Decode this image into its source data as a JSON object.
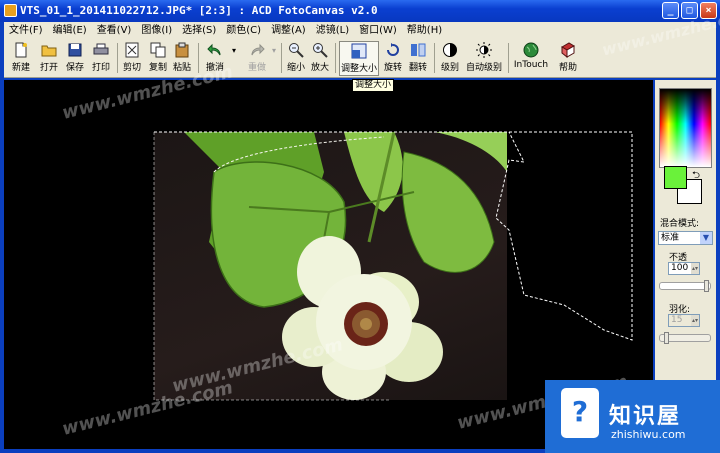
{
  "window": {
    "title": "VTS_01_1_201411022712.JPG* [2:3] : ACD FotoCanvas v2.0",
    "controls": [
      "_",
      "□",
      "×"
    ]
  },
  "menu": [
    "文件(F)",
    "编辑(E)",
    "查看(V)",
    "图像(I)",
    "选择(S)",
    "颜色(C)",
    "调整(A)",
    "滤镜(L)",
    "窗口(W)",
    "帮助(H)"
  ],
  "toolbar": {
    "new": "新建",
    "open": "打开",
    "save": "保存",
    "print": "打印",
    "cut": "剪切",
    "copy": "复制",
    "paste": "粘贴",
    "undo": "撤消",
    "redo": "重做",
    "zoom_out": "缩小",
    "zoom_in": "放大",
    "resize": "调整大小",
    "rotate": "旋转",
    "flip": "翻转",
    "levels": "级别",
    "auto_levels": "自动级别",
    "intouch": "InTouch",
    "help": "帮助"
  },
  "tooltip": "调整大小",
  "panel": {
    "blend_label": "混合模式:",
    "blend_value": "标准",
    "opacity_label": "不透",
    "opacity_value": "100",
    "feather_label": "羽化:",
    "feather_value": "15",
    "fg_color": "#6af23a",
    "bg_color": "#ffffff"
  },
  "watermark": "www.wmzhe.com",
  "badge": {
    "name": "知识屋",
    "url": "zhishiwu.com"
  },
  "colors": {
    "accent": "#1f6dd5",
    "titlebar": "#0a3fd0",
    "chrome": "#ece9d8"
  }
}
